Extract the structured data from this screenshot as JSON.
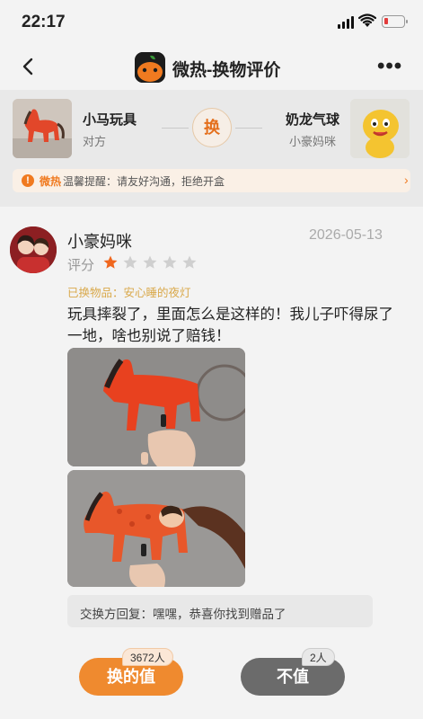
{
  "status_bar": {
    "time": "22:17"
  },
  "nav": {
    "title": "微热-换物评价",
    "more": "•••"
  },
  "exchange": {
    "left": {
      "name": "小马玩具",
      "owner": "对方",
      "image": "red-toy-horse"
    },
    "swap_label": "换",
    "right": {
      "name": "奶龙气球",
      "owner": "小豪妈咪",
      "image": "yellow-nailong-balloon"
    },
    "tip": {
      "brand": "微热",
      "text": "温馨提醒：请友好沟通，拒绝开盒"
    }
  },
  "review": {
    "reviewer": "小豪妈咪",
    "date": "2026-05-13",
    "rating_label": "评分",
    "rating": 1,
    "rating_max": 5,
    "exchanged_item": "已换物品：安心睡的夜灯",
    "comment": "玩具摔裂了，里面怎么是这样的！我儿子吓得尿了一地，啥也别说了赔钱！",
    "photos": [
      "toy-horse-intact",
      "toy-horse-broken-inside"
    ],
    "reply": "交换方回复：嘿嘿，恭喜你找到赠品了"
  },
  "votes": {
    "worth_label": "换的值",
    "worth_count": "3672人",
    "not_worth_label": "不值",
    "not_worth_count": "2人"
  },
  "colors": {
    "accent": "#ef8a2f",
    "star_on": "#f0671e",
    "star_off": "#cfcfcf",
    "muted_button": "#6b6b6b"
  }
}
